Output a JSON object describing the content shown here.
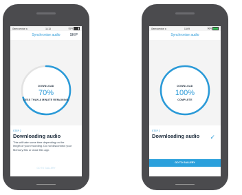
{
  "screens": [
    {
      "status": {
        "carrier": "Geen service",
        "time": "11:13",
        "battery": "81%",
        "battery_level": 0.81
      },
      "nav": {
        "title": "Synchronise audio",
        "skip": "SKIP"
      },
      "progress": {
        "label": "DOWNLOAD",
        "percent_text": "70%",
        "value": 0.7,
        "sub": "LESS THAN A MINUTE REMAINING"
      },
      "step": "STEP 2",
      "heading": "Downloading audio",
      "description": "This will take some time depending on the length of your recording. Do not disconnect your Memory Mic or close this app.",
      "action": "GO TO GALLERY"
    },
    {
      "status": {
        "carrier": "Geen service",
        "time": "13:09",
        "battery": "96%",
        "battery_level": 0.96
      },
      "nav": {
        "title": "Synchronise audio"
      },
      "progress": {
        "label": "DOWNLOAD",
        "percent_text": "100%",
        "value": 1.0,
        "sub": "COMPLETE"
      },
      "step": "STEP 2",
      "heading": "Downloading audio",
      "action": "GO TO GALLERY"
    }
  ],
  "colors": {
    "accent": "#2a9ad8",
    "track": "#e0e0e0",
    "phone": "#4b4b4e"
  },
  "icons": {
    "check": "checkmark-icon",
    "wifi": "wifi-icon",
    "battery": "battery-icon"
  }
}
